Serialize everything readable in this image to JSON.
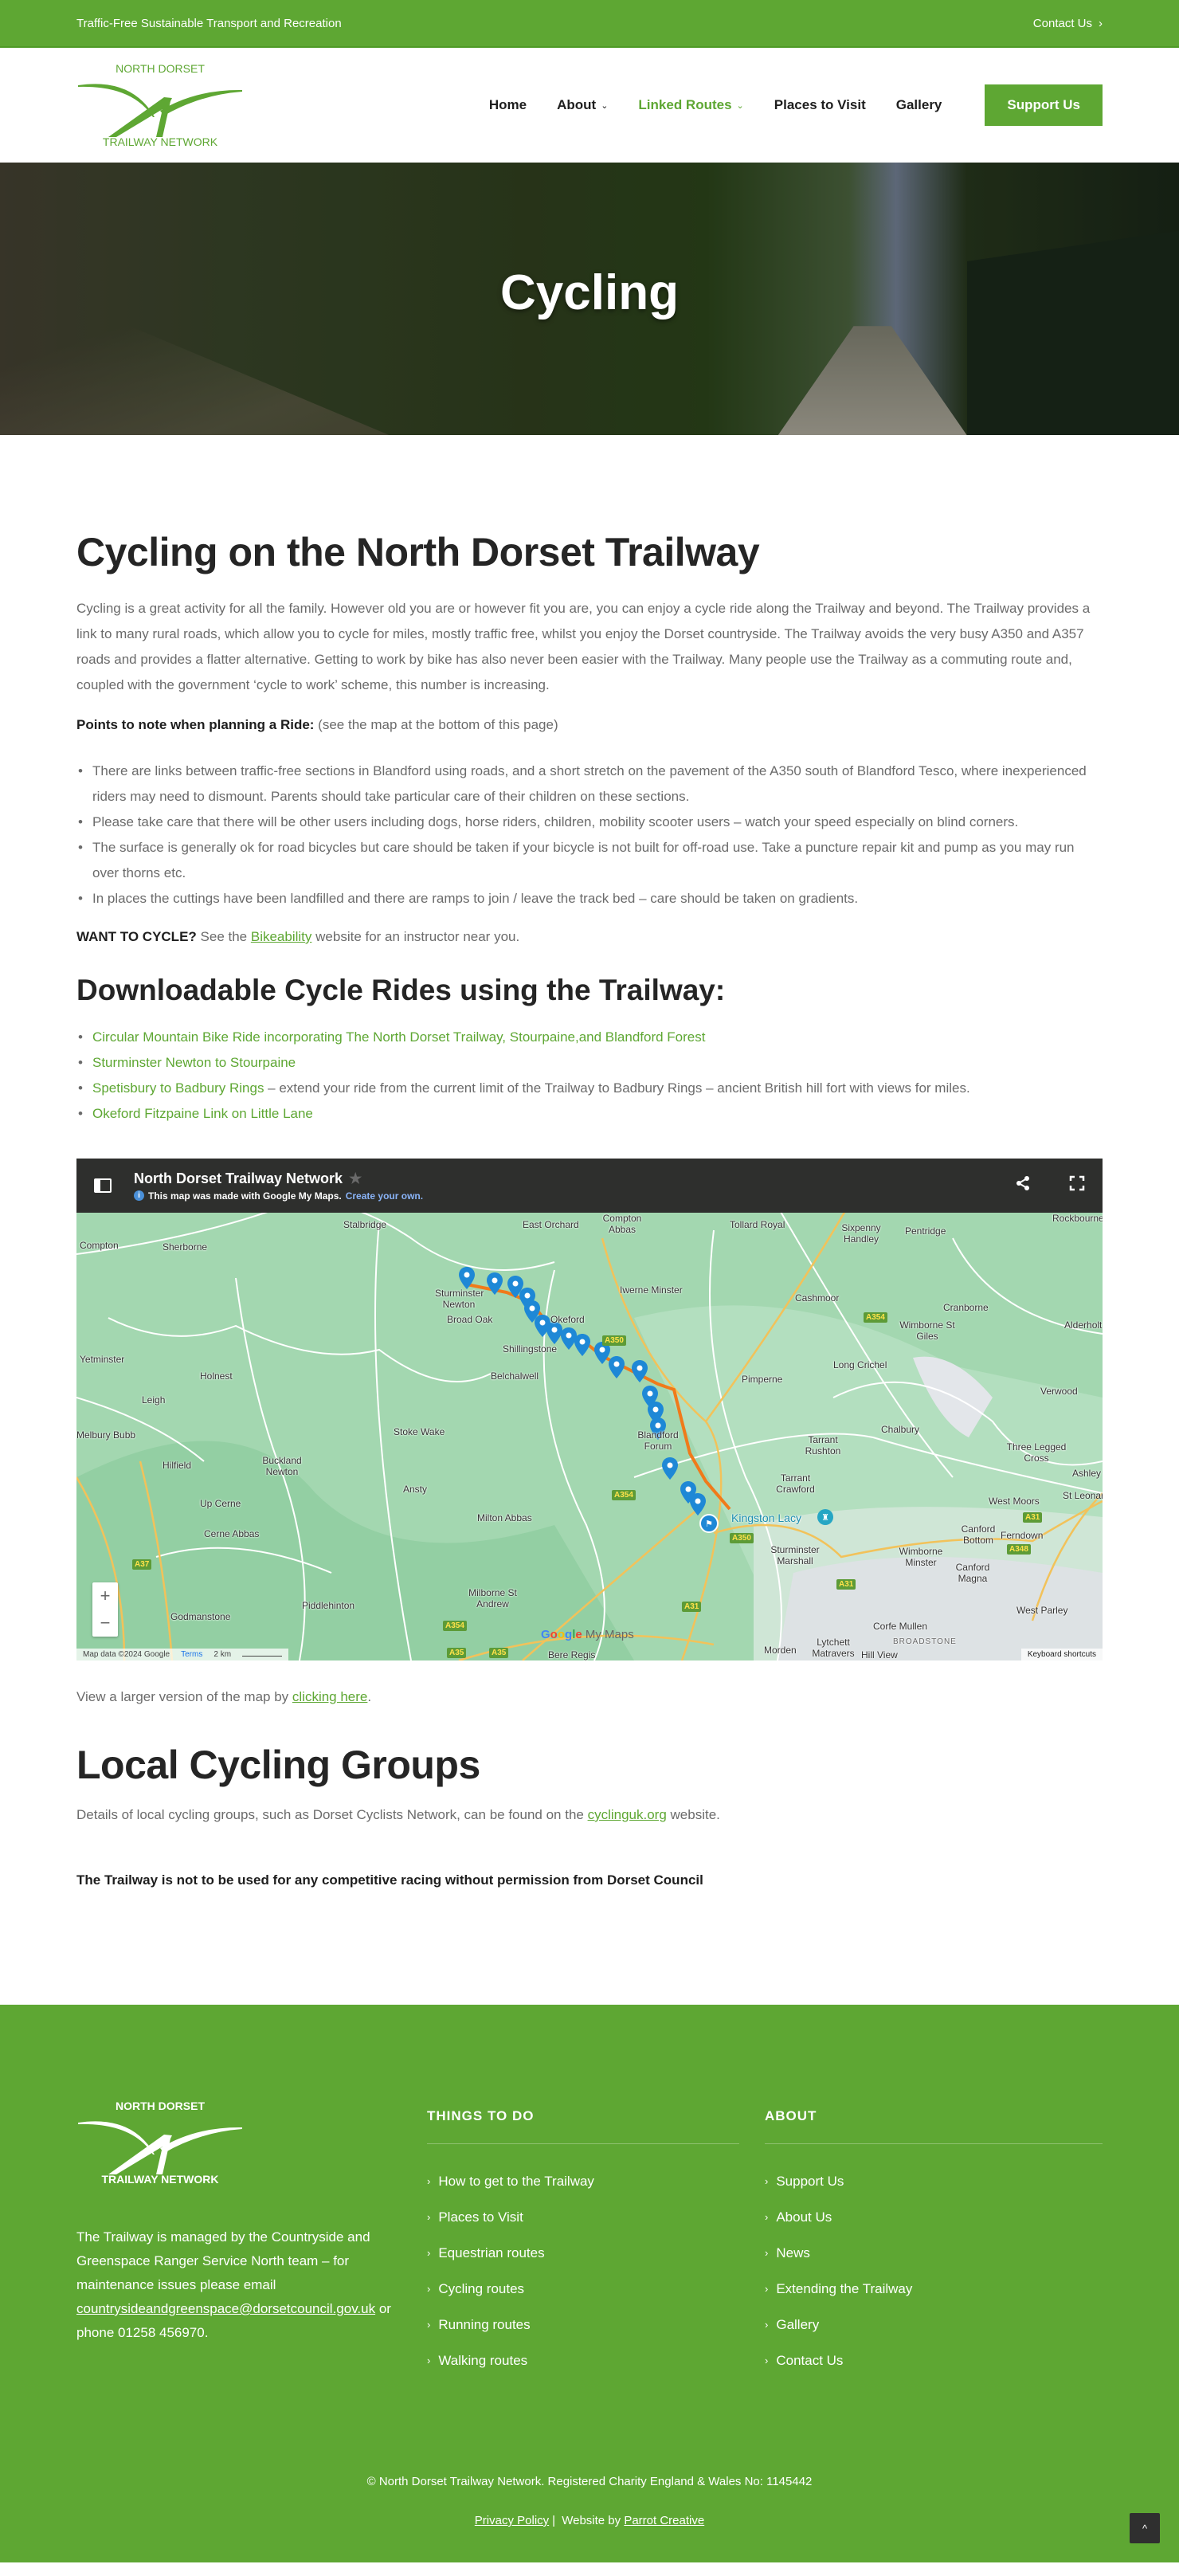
{
  "topbar": {
    "tagline": "Traffic-Free Sustainable Transport and Recreation",
    "contact_label": "Contact Us"
  },
  "logo": {
    "line1": "NORTH DORSET",
    "line2": "TRAILWAY  NETWORK",
    "brand_color": "#5ea733"
  },
  "nav": {
    "items": [
      {
        "label": "Home",
        "dropdown": false,
        "active": false
      },
      {
        "label": "About",
        "dropdown": true,
        "active": false
      },
      {
        "label": "Linked Routes",
        "dropdown": true,
        "active": true
      },
      {
        "label": "Places to Visit",
        "dropdown": false,
        "active": false
      },
      {
        "label": "Gallery",
        "dropdown": false,
        "active": false
      }
    ],
    "support_button": "Support Us"
  },
  "hero": {
    "title": "Cycling"
  },
  "main": {
    "heading": "Cycling on the North Dorset Trailway",
    "intro": "Cycling is a great activity for all the family. However old you are or however fit you are, you can enjoy a cycle ride along the Trailway and beyond. The Trailway provides a link to many rural roads, which allow you to cycle for miles, mostly traffic free, whilst you enjoy the Dorset countryside. The Trailway avoids the very busy A350 and A357 roads and provides a flatter alternative. Getting to work by bike has also never been easier with the Trailway. Many people use the Trailway as a commuting route and, coupled with the government ‘cycle to work’ scheme, this number is increasing.",
    "points_label": "Points to note when planning a Ride:",
    "points_note": " (see the map at the bottom of this page)",
    "points": [
      "There are links between traffic-free sections in Blandford using roads, and a short stretch on the pavement of the A350 south of Blandford Tesco, where inexperienced riders may need to dismount. Parents should take particular care of their children on these sections.",
      "Please take care that there will be other users including dogs, horse riders, children, mobility scooter users – watch your speed especially on blind corners.",
      "The surface is generally ok for road bicycles but care should be taken if your bicycle is not built for off-road use. Take a puncture repair kit and pump as you may run over thorns etc.",
      "In places the cuttings have been landfilled and there are ramps to join / leave the track bed – care should be taken on gradients."
    ],
    "want_label": "WANT TO CYCLE?",
    "want_pre": " See the ",
    "want_link": "Bikeability",
    "want_post": " website for an instructor near you.",
    "downloads_heading": "Downloadable Cycle Rides using the Trailway:",
    "downloads": [
      {
        "link": "Circular Mountain Bike Ride incorporating The North Dorset Trailway, Stourpaine,and Blandford Forest",
        "suffix": ""
      },
      {
        "link": "Sturminster Newton to Stourpaine",
        "suffix": ""
      },
      {
        "link": "Spetisbury to Badbury Rings",
        "suffix": " – extend your ride from the current limit of the Trailway to Badbury Rings – ancient British hill fort with views for miles."
      },
      {
        "link": "Okeford Fitzpaine Link on Little Lane",
        "suffix": ""
      }
    ],
    "map_link_pre": "View a larger version of the map by ",
    "map_link": "clicking here",
    "map_link_post": ".",
    "groups_heading": "Local Cycling Groups",
    "groups_pre": "Details of local cycling groups, such as Dorset Cyclists Network, can be found on the ",
    "groups_link": "cyclinguk.org",
    "groups_post": " website.",
    "racing_note": "The Trailway is not to be used for any competitive racing without permission from Dorset Council"
  },
  "map": {
    "title": "North Dorset Trailway Network",
    "subtitle": "This map was made with Google My Maps.",
    "create_link": "Create your own.",
    "share_icon": "share-icon",
    "fullscreen_icon": "fullscreen-icon",
    "zoom_in": "+",
    "zoom_out": "−",
    "attribution": "Map data ©2024 Google",
    "terms": "Terms",
    "scale": "2 km",
    "keyboard": "Keyboard shortcuts",
    "logo_google": "Google",
    "logo_mymaps": " My Maps",
    "places": [
      {
        "name": "Stalbridge"
      },
      {
        "name": "East Orchard"
      },
      {
        "name": "Compton Abbas"
      },
      {
        "name": "Tollard Royal"
      },
      {
        "name": "Sixpenny Handley"
      },
      {
        "name": "Pentridge"
      },
      {
        "name": "Rockbourne"
      },
      {
        "name": "Compton"
      },
      {
        "name": "Sherborne"
      },
      {
        "name": "Iwerne Minster"
      },
      {
        "name": "Cashmoor"
      },
      {
        "name": "Cranborne"
      },
      {
        "name": "Wimborne St Giles"
      },
      {
        "name": "Alderholt"
      },
      {
        "name": "Sturminster Newton"
      },
      {
        "name": "Broad Oak"
      },
      {
        "name": "Okeford"
      },
      {
        "name": "Shillingstone"
      },
      {
        "name": "Yetminster"
      },
      {
        "name": "Holnest"
      },
      {
        "name": "Leigh"
      },
      {
        "name": "Belchalwell"
      },
      {
        "name": "Long Crichel"
      },
      {
        "name": "Pimperne"
      },
      {
        "name": "Verwood"
      },
      {
        "name": "Melbury Bubb"
      },
      {
        "name": "Stoke Wake"
      },
      {
        "name": "Blandford Forum"
      },
      {
        "name": "Tarrant Rushton"
      },
      {
        "name": "Chalbury"
      },
      {
        "name": "Three Legged Cross"
      },
      {
        "name": "Hilfield"
      },
      {
        "name": "Buckland Newton"
      },
      {
        "name": "Ansty"
      },
      {
        "name": "Tarrant Crawford"
      },
      {
        "name": "Ashley Heath"
      },
      {
        "name": "St Leonards"
      },
      {
        "name": "West Moors"
      },
      {
        "name": "Up Cerne"
      },
      {
        "name": "Milton Abbas"
      },
      {
        "name": "Kingston Lacy"
      },
      {
        "name": "Cerne Abbas"
      },
      {
        "name": "Canford Bottom"
      },
      {
        "name": "Ferndown"
      },
      {
        "name": "Sturminster Marshall"
      },
      {
        "name": "Wimborne Minster"
      },
      {
        "name": "Canford Magna"
      },
      {
        "name": "Milborne St Andrew"
      },
      {
        "name": "Piddlehinton"
      },
      {
        "name": "Godmanstone"
      },
      {
        "name": "West Parley"
      },
      {
        "name": "Corfe Mullen"
      },
      {
        "name": "BROADSTONE"
      },
      {
        "name": "Morden"
      },
      {
        "name": "Lytchett Matravers"
      },
      {
        "name": "Hill View"
      },
      {
        "name": "Bere Regis"
      }
    ],
    "roads": [
      "A350",
      "A354",
      "A354",
      "A350",
      "A37",
      "A31",
      "A31",
      "A31",
      "A348",
      "A354",
      "A35",
      "A35"
    ]
  },
  "footer": {
    "logo_line1": "NORTH DORSET",
    "logo_line2": "TRAILWAY  NETWORK",
    "about_text": "The Trailway is managed by the Countryside and Greenspace Ranger Service North team – for maintenance issues please email ",
    "email": "countrysideandgreenspace@dorsetcouncil.gov.uk",
    "phone_text": " or phone 01258 456970.",
    "col2_heading": "THINGS TO DO",
    "col2_items": [
      "How to get to the Trailway",
      "Places to Visit",
      "Equestrian routes",
      "Cycling routes",
      "Running routes",
      "Walking routes"
    ],
    "col3_heading": "ABOUT",
    "col3_items": [
      "Support Us",
      "About Us",
      "News",
      "Extending the Trailway",
      "Gallery",
      "Contact Us"
    ],
    "copyright": "© North Dorset Trailway Network. Registered Charity England & Wales No: 1145442",
    "privacy": "Privacy Policy",
    "sep": "|",
    "website_by": " Website by ",
    "agency": "Parrot Creative",
    "back_to_top": "^"
  }
}
